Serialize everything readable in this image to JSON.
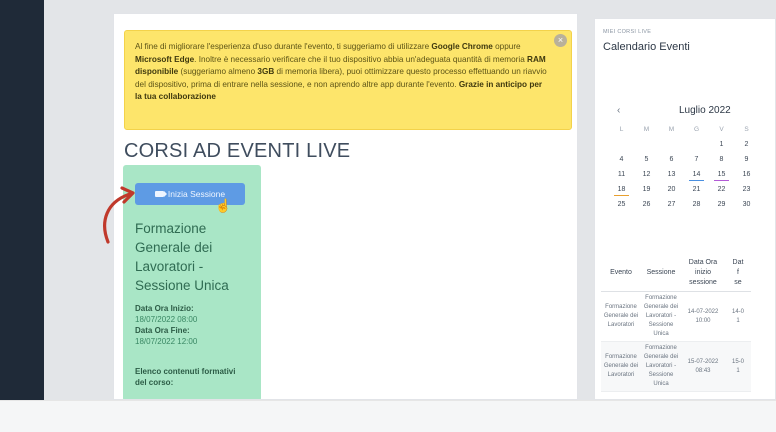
{
  "alert": {
    "close_glyph": "×",
    "parts": [
      {
        "t": "Al fine di migliorare l'esperienza d'uso durante l'evento, ti suggeriamo di utilizzare ",
        "b": false
      },
      {
        "t": "Google Chrome",
        "b": true
      },
      {
        "t": " oppure ",
        "b": false
      },
      {
        "t": "Microsoft Edge",
        "b": true
      },
      {
        "t": ". Inoltre è necessario verificare che il tuo dispositivo abbia un'adeguata quantità di memoria ",
        "b": false
      },
      {
        "t": "RAM disponibile",
        "b": true
      },
      {
        "t": " (suggeriamo almeno ",
        "b": false
      },
      {
        "t": "3GB",
        "b": true
      },
      {
        "t": " di memoria libera), puoi ottimizzare questo processo effettuando un riavvio del dispositivo, prima di entrare nella sessione, e non aprendo altre app durante l'evento. ",
        "b": false
      },
      {
        "t": "Grazie in anticipo per la tua collaborazione",
        "b": true
      }
    ]
  },
  "page_title": "CORSI AD EVENTI LIVE",
  "course_card": {
    "start_button": "Inizia Sessione",
    "title_lines": [
      "Formazione",
      "Generale dei",
      "Lavoratori -",
      "Sessione Unica"
    ],
    "start_label": "Data Ora Inizio:",
    "start_value": "18/07/2022 08:00",
    "end_label": "Data Ora Fine:",
    "end_value": "18/07/2022 12:00",
    "contents_label_1": "Elenco contenuti formativi",
    "contents_label_2": "del corso:"
  },
  "calendar": {
    "mini_label": "MIEI CORSI LIVE",
    "title": "Calendario Eventi",
    "prev": "‹",
    "month": "Luglio 2022",
    "weekdays": [
      "L",
      "M",
      "M",
      "G",
      "V",
      "S"
    ],
    "weeks": [
      [
        "",
        "",
        "",
        "",
        "1",
        "2"
      ],
      [
        "4",
        "5",
        "6",
        "7",
        "8",
        "9"
      ],
      [
        "11",
        "12",
        "13",
        "14",
        "15",
        "16"
      ],
      [
        "18",
        "19",
        "20",
        "21",
        "22",
        "23"
      ],
      [
        "25",
        "26",
        "27",
        "28",
        "29",
        "30"
      ]
    ],
    "marks": {
      "14": "blue",
      "15": "purple",
      "18": "orange"
    }
  },
  "events_table": {
    "headers": [
      [
        "Evento"
      ],
      [
        "Sessione"
      ],
      [
        "Data Ora",
        "inizio",
        "sessione"
      ],
      [
        "Dat",
        "f",
        "se"
      ]
    ],
    "rows": [
      {
        "evento": [
          "Formazione",
          "Generale dei",
          "Lavoratori"
        ],
        "sessione": [
          "Formazione",
          "Generale dei",
          "Lavoratori -",
          "Sessione",
          "Unica"
        ],
        "inizio": [
          "14-07-2022",
          "10:00"
        ],
        "fine": [
          "14-0",
          "1"
        ]
      },
      {
        "evento": [
          "Formazione",
          "Generale dei",
          "Lavoratori"
        ],
        "sessione": [
          "Formazione",
          "Generale dei",
          "Lavoratori -",
          "Sessione",
          "Unica"
        ],
        "inizio": [
          "15-07-2022",
          "08:43"
        ],
        "fine": [
          "15-0",
          "1"
        ]
      }
    ]
  },
  "colors": {
    "alert_bg": "#fde56b",
    "card_bg": "#a9e6c6",
    "button_bg": "#5e9be4",
    "arrow": "#c0392b"
  }
}
